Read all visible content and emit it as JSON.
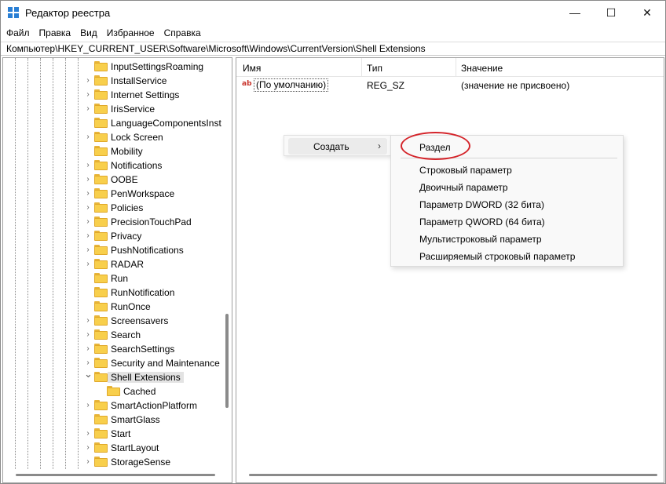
{
  "window": {
    "title": "Редактор реестра",
    "minimize_glyph": "—",
    "maximize_glyph": "☐",
    "close_glyph": "✕"
  },
  "menu": [
    "Файл",
    "Правка",
    "Вид",
    "Избранное",
    "Справка"
  ],
  "address": "Компьютер\\HKEY_CURRENT_USER\\Software\\Microsoft\\Windows\\CurrentVersion\\Shell Extensions",
  "tree": {
    "items": [
      {
        "label": "InputSettingsRoaming",
        "expandable": false
      },
      {
        "label": "InstallService",
        "expandable": true
      },
      {
        "label": "Internet Settings",
        "expandable": true
      },
      {
        "label": "IrisService",
        "expandable": true
      },
      {
        "label": "LanguageComponentsInst",
        "expandable": false
      },
      {
        "label": "Lock Screen",
        "expandable": true
      },
      {
        "label": "Mobility",
        "expandable": false
      },
      {
        "label": "Notifications",
        "expandable": true
      },
      {
        "label": "OOBE",
        "expandable": true
      },
      {
        "label": "PenWorkspace",
        "expandable": true
      },
      {
        "label": "Policies",
        "expandable": true
      },
      {
        "label": "PrecisionTouchPad",
        "expandable": true
      },
      {
        "label": "Privacy",
        "expandable": true
      },
      {
        "label": "PushNotifications",
        "expandable": true
      },
      {
        "label": "RADAR",
        "expandable": true
      },
      {
        "label": "Run",
        "expandable": false
      },
      {
        "label": "RunNotification",
        "expandable": false
      },
      {
        "label": "RunOnce",
        "expandable": false
      },
      {
        "label": "Screensavers",
        "expandable": true
      },
      {
        "label": "Search",
        "expandable": true
      },
      {
        "label": "SearchSettings",
        "expandable": true
      },
      {
        "label": "Security and Maintenance",
        "expandable": true
      },
      {
        "label": "Shell Extensions",
        "expandable": true,
        "expanded": true,
        "selected": true
      },
      {
        "label": "Cached",
        "expandable": false,
        "child": true
      },
      {
        "label": "SmartActionPlatform",
        "expandable": true
      },
      {
        "label": "SmartGlass",
        "expandable": false
      },
      {
        "label": "Start",
        "expandable": true
      },
      {
        "label": "StartLayout",
        "expandable": true
      },
      {
        "label": "StorageSense",
        "expandable": true
      }
    ]
  },
  "values": {
    "columns": [
      "Имя",
      "Тип",
      "Значение"
    ],
    "rows": [
      {
        "name": "(По умолчанию)",
        "type": "REG_SZ",
        "data": "(значение не присвоено)",
        "icon": "ab"
      }
    ]
  },
  "context_menu": {
    "item": "Создать",
    "arrow": "›"
  },
  "submenu": {
    "items": [
      "Раздел",
      "Строковый параметр",
      "Двоичный параметр",
      "Параметр DWORD (32 бита)",
      "Параметр QWORD (64 бита)",
      "Мультистроковый параметр",
      "Расширяемый строковый параметр"
    ]
  },
  "colors": {
    "folder": "#f8cf4c",
    "annotation_oval": "#d4242a",
    "selection": "#e3e3e3"
  }
}
